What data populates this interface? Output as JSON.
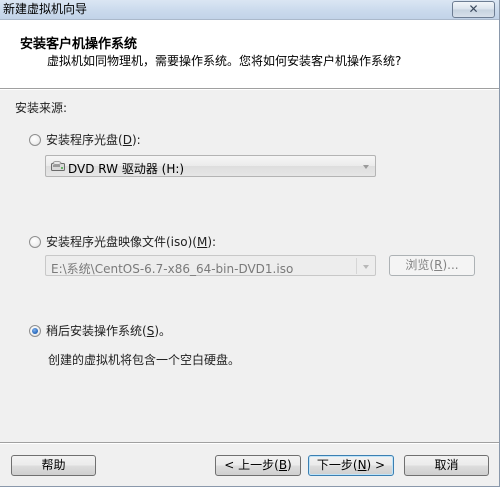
{
  "window": {
    "title": "新建虚拟机向导",
    "close_glyph": "✕"
  },
  "header": {
    "heading": "安装客户机操作系统",
    "subheading": "虚拟机如同物理机，需要操作系统。您将如何安装客户机操作系统?"
  },
  "source": {
    "label": "安装来源:",
    "options": [
      {
        "prefix": "安装程序光盘(",
        "hotkey": "D",
        "suffix": "):",
        "selected": false
      },
      {
        "prefix": "安装程序光盘映像文件(iso)(",
        "hotkey": "M",
        "suffix": "):",
        "selected": false
      },
      {
        "prefix": "稍后安装操作系统(",
        "hotkey": "S",
        "suffix": ")。",
        "selected": true
      }
    ],
    "disc_drive": {
      "value": "DVD RW 驱动器 (H:)",
      "icon": "dvd-drive-icon"
    },
    "iso_path": {
      "value": "E:\\系统\\CentOS-6.7-x86_64-bin-DVD1.iso"
    },
    "browse": {
      "prefix": "浏览(",
      "hotkey": "R",
      "suffix": ")..."
    },
    "later_description": "创建的虚拟机将包含一个空白硬盘。"
  },
  "footer": {
    "help": "帮助",
    "back": {
      "prefix": "< 上一步(",
      "hotkey": "B",
      "suffix": ")"
    },
    "next": {
      "prefix": "下一步(",
      "hotkey": "N",
      "suffix": ") >"
    },
    "cancel": "取消"
  }
}
